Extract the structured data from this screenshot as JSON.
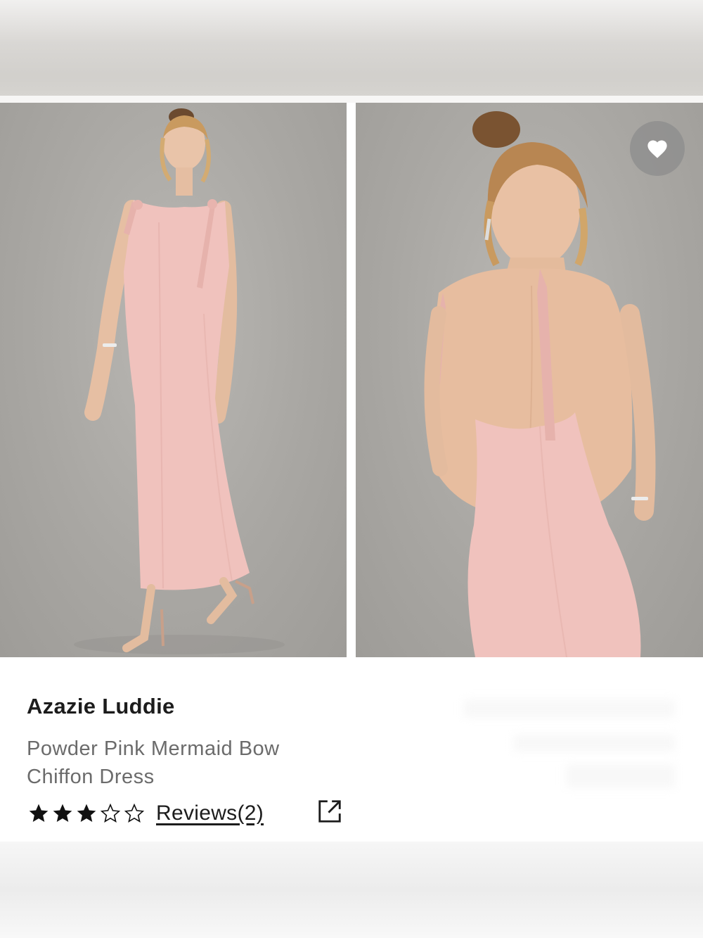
{
  "product": {
    "brand": "Azazie Luddie",
    "name": "Powder Pink Mermaid Bow Chiffon Dress",
    "rating": 3,
    "rating_max": 5,
    "reviews_label": "Reviews(2)"
  },
  "gallery": {
    "images": [
      {
        "name": "front-view",
        "alt": "front-view"
      },
      {
        "name": "back-view",
        "alt": "back-view"
      }
    ]
  },
  "icons": {
    "favorite": "heart-icon",
    "external": "external-link-icon",
    "star_filled": "star-filled-icon",
    "star_empty": "star-outline-icon"
  },
  "colors": {
    "dress": "#f0c2bd",
    "background": "#aaa8a4",
    "text_primary": "#1c1c1c",
    "text_secondary": "#6b6b6b"
  }
}
